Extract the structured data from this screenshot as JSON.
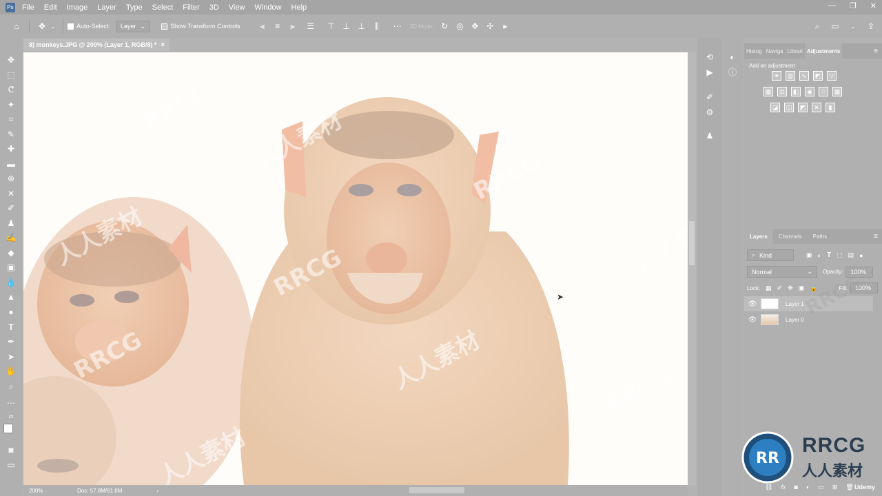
{
  "app": {
    "logo": "Ps"
  },
  "menu": [
    "File",
    "Edit",
    "Image",
    "Layer",
    "Type",
    "Select",
    "Filter",
    "3D",
    "View",
    "Window",
    "Help"
  ],
  "options_bar": {
    "auto_select_label": "Auto-Select:",
    "auto_select_value": "Layer",
    "show_transform_label": "Show Transform Controls",
    "mode_3d_label": "3D Mode:"
  },
  "document": {
    "tab_title": "8) monkeys.JPG @ 200% (Layer 1, RGB/8) *",
    "close_symbol": "×",
    "zoom": "200%",
    "doc_size": "Doc: 57.8M/61.8M"
  },
  "panels": {
    "top_tabs": [
      "Histog",
      "Naviga",
      "Librari",
      "Adjustments"
    ],
    "adjustments_title": "Add an adjustment",
    "layers_tabs": [
      "Layers",
      "Channels",
      "Paths"
    ],
    "filter_kind": "Kind",
    "blend_mode": "Normal",
    "opacity_label": "Opacity:",
    "opacity_value": "100%",
    "lock_label": "Lock:",
    "fill_label": "Fill:",
    "fill_value": "100%",
    "layers": [
      {
        "name": "Layer 1",
        "selected": true
      },
      {
        "name": "Layer 0",
        "selected": false
      }
    ],
    "footer_fx": "fx"
  },
  "watermarks": {
    "brand": "RRCG",
    "cn": "人人素材",
    "udemy": "Udemy"
  },
  "colors": {
    "ui_bg": "#b3b3b3",
    "canvas_bg": "#fffdfa",
    "logo_blue": "#2d7fc1"
  }
}
